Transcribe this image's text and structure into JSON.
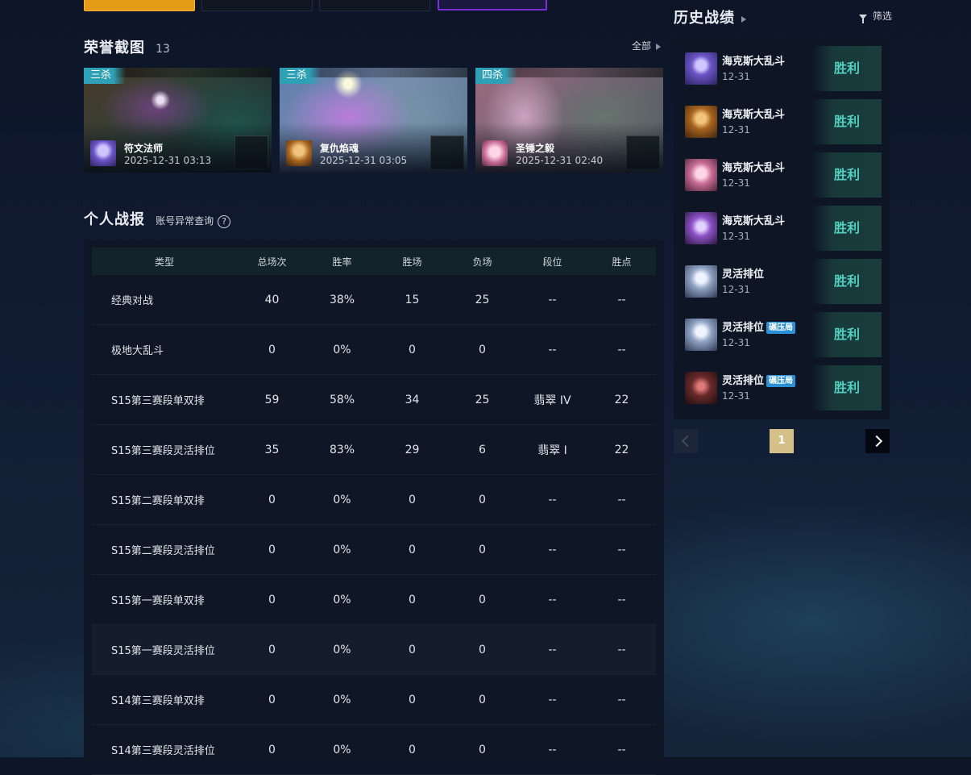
{
  "honor": {
    "title": "荣誉截图",
    "count": "13",
    "all_label": "全部",
    "clips": [
      {
        "tag": "三杀",
        "champion": "符文法师",
        "time": "2025-12-31 03:13"
      },
      {
        "tag": "三杀",
        "champion": "复仇焰魂",
        "time": "2025-12-31 03:05"
      },
      {
        "tag": "四杀",
        "champion": "圣锤之毅",
        "time": "2025-12-31 02:40"
      }
    ]
  },
  "report": {
    "title": "个人战报",
    "query_link": "账号异常查询",
    "help_icon": "?",
    "columns": [
      "类型",
      "总场次",
      "胜率",
      "胜场",
      "负场",
      "段位",
      "胜点"
    ],
    "rows": [
      [
        "经典对战",
        "40",
        "38%",
        "15",
        "25",
        "--",
        "--"
      ],
      [
        "极地大乱斗",
        "0",
        "0%",
        "0",
        "0",
        "--",
        "--"
      ],
      [
        "S15第三赛段单双排",
        "59",
        "58%",
        "34",
        "25",
        "翡翠 IV",
        "22"
      ],
      [
        "S15第三赛段灵活排位",
        "35",
        "83%",
        "29",
        "6",
        "翡翠 I",
        "22"
      ],
      [
        "S15第二赛段单双排",
        "0",
        "0%",
        "0",
        "0",
        "--",
        "--"
      ],
      [
        "S15第二赛段灵活排位",
        "0",
        "0%",
        "0",
        "0",
        "--",
        "--"
      ],
      [
        "S15第一赛段单双排",
        "0",
        "0%",
        "0",
        "0",
        "--",
        "--"
      ],
      [
        "S15第一赛段灵活排位",
        "0",
        "0%",
        "0",
        "0",
        "--",
        "--"
      ],
      [
        "S14第三赛段单双排",
        "0",
        "0%",
        "0",
        "0",
        "--",
        "--"
      ],
      [
        "S14第三赛段灵活排位",
        "0",
        "0%",
        "0",
        "0",
        "--",
        "--"
      ]
    ]
  },
  "history": {
    "title": "历史战绩",
    "filter_label": "筛选",
    "items": [
      {
        "mode": "海克斯大乱斗",
        "badge": "",
        "date": "12-31",
        "result": "胜利",
        "avatar": "purple"
      },
      {
        "mode": "海克斯大乱斗",
        "badge": "",
        "date": "12-31",
        "result": "胜利",
        "avatar": "orange"
      },
      {
        "mode": "海克斯大乱斗",
        "badge": "",
        "date": "12-31",
        "result": "胜利",
        "avatar": "pink"
      },
      {
        "mode": "海克斯大乱斗",
        "badge": "",
        "date": "12-31",
        "result": "胜利",
        "avatar": "violet"
      },
      {
        "mode": "灵活排位",
        "badge": "",
        "date": "12-31",
        "result": "胜利",
        "avatar": "wolf"
      },
      {
        "mode": "灵活排位",
        "badge": "碾压局",
        "date": "12-31",
        "result": "胜利",
        "avatar": "wolf"
      },
      {
        "mode": "灵活排位",
        "badge": "碾压局",
        "date": "12-31",
        "result": "胜利",
        "avatar": "dark"
      }
    ],
    "pagination": {
      "current": "1"
    }
  },
  "colors": {
    "accent_win": "#52d1c0",
    "tag_teal": "#2fa1b6",
    "badge_blue": "#2a91d8",
    "page_gold": "#d6c08a",
    "tile_orange": "#e49b18",
    "tile_purple": "#7b2fd4"
  },
  "icons": [
    "filter-icon",
    "chevron-right-icon",
    "chevron-left-icon",
    "help-icon"
  ]
}
